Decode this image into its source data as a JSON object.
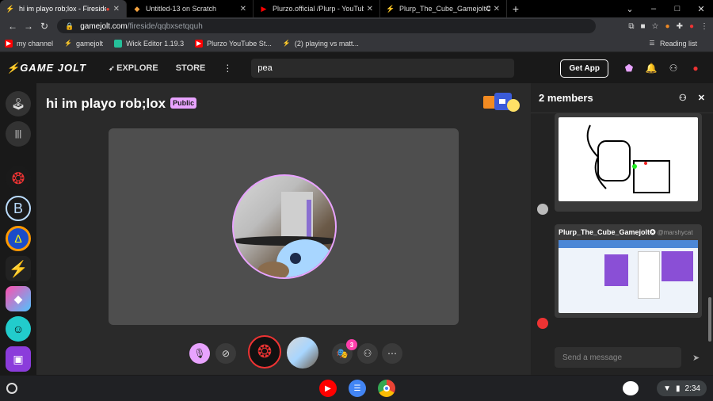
{
  "browser": {
    "tabs": [
      {
        "title": "hi im playo rob;lox - Fireside",
        "active": true
      },
      {
        "title": "Untitled-13 on Scratch",
        "active": false
      },
      {
        "title": "Plurzo.official /Plurp - YouTube",
        "active": false
      },
      {
        "title": "Plurp_The_Cube_Gamejolt✪ (@",
        "active": false
      }
    ],
    "url_host": "gamejolt.com",
    "url_path": "/fireside/qqbxsetqquh",
    "bookmarks": [
      "my channel",
      "gamejolt",
      "Wick Editor 1.19.3",
      "Plurzo YouTube St...",
      "(2) playing vs matt..."
    ],
    "reading_list": "Reading list"
  },
  "gamejolt": {
    "logo": "GAME JOLT",
    "nav": {
      "explore": "EXPLORE",
      "store": "STORE"
    },
    "search_value": "pea",
    "get_app": "Get App"
  },
  "fireside": {
    "title": "hi im playo rob;lox",
    "badge": "Public",
    "notification_count": "3"
  },
  "side": {
    "members_count": "2",
    "members_label": "members",
    "post_user": "Plurp_The_Cube_Gamejolt✪",
    "post_handle": "@marshycat",
    "message_placeholder": "Send a message"
  },
  "taskbar": {
    "time": "2:34"
  },
  "colors": {
    "accent": "#e8a3ff",
    "pink": "#ff3fac",
    "bg": "#2a2a2a",
    "stage": "#4e4e4e"
  }
}
